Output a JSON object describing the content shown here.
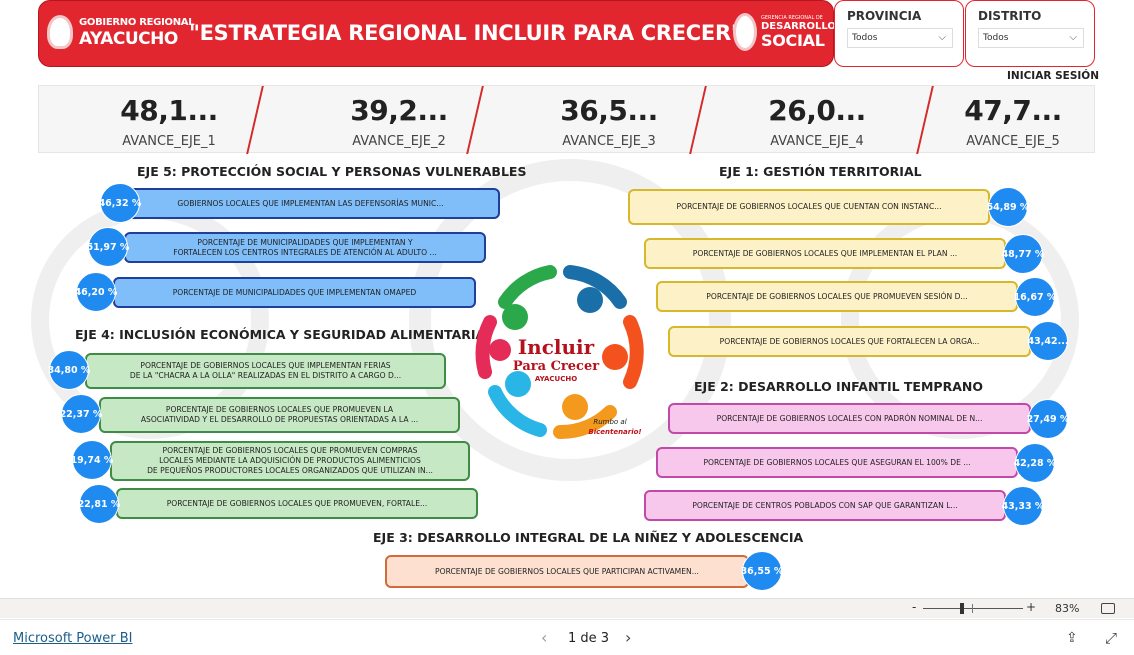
{
  "header": {
    "org_logo_line1": "GOBIERNO REGIONAL",
    "org_logo_line2": "AYACUCHO",
    "title": "\"ESTRATEGIA REGIONAL INCLUIR PARA CRECER\"",
    "dept_logo_line1": "GERENCIA REGIONAL DE",
    "dept_logo_line2": "DESARROLLO",
    "dept_logo_line3": "SOCIAL"
  },
  "filters": {
    "provincia": {
      "label": "PROVINCIA",
      "value": "Todos"
    },
    "distrito": {
      "label": "DISTRITO",
      "value": "Todos"
    }
  },
  "login_label": "INICIAR SESIÓN",
  "kpis": [
    {
      "value": "48,1...",
      "label": "AVANCE_EJE_1"
    },
    {
      "value": "39,2...",
      "label": "AVANCE_EJE_2"
    },
    {
      "value": "36,5...",
      "label": "AVANCE_EJE_3"
    },
    {
      "value": "26,0...",
      "label": "AVANCE_EJE_4"
    },
    {
      "value": "47,7...",
      "label": "AVANCE_EJE_5"
    }
  ],
  "eje5": {
    "title": "EJE 5: PROTECCIÓN SOCIAL Y PERSONAS VULNERABLES",
    "items": [
      {
        "pct": "46,32 %",
        "text": "GOBIERNOS LOCALES QUE IMPLEMENTAN LAS DEFENSORÍAS MUNIC..."
      },
      {
        "pct": "51,97 %",
        "text": "PORCENTAJE DE MUNICIPALIDADES QUE IMPLEMENTAN Y\nFORTALECEN LOS CENTROS INTEGRALES DE ATENCIÓN AL ADULTO ..."
      },
      {
        "pct": "46,20 %",
        "text": "PORCENTAJE DE MUNICIPALIDADES QUE IMPLEMENTAN OMAPED"
      }
    ]
  },
  "eje4": {
    "title": "EJE 4: INCLUSIÓN ECONÓMICA Y SEGURIDAD ALIMENTARIA",
    "items": [
      {
        "pct": "34,80 %",
        "text": "PORCENTAJE DE GOBIERNOS LOCALES QUE IMPLEMENTAN FERIAS\nDE LA \"CHACRA A LA OLLA\" REALIZADAS EN EL DISTRITO A CARGO D..."
      },
      {
        "pct": "22,37 %",
        "text": "PORCENTAJE DE GOBIERNOS LOCALES QUE PROMUEVEN LA\nASOCIATIVIDAD Y EL DESARROLLO DE PROPUESTAS ORIENTADAS A LA ..."
      },
      {
        "pct": "19,74 %",
        "text": "PORCENTAJE DE GOBIERNOS LOCALES QUE PROMUEVEN COMPRAS\nLOCALES MEDIANTE LA ADQUISICIÓN DE PRODUCTOS ALIMENTICIOS\nDE PEQUEÑOS PRODUCTORES LOCALES ORGANIZADOS QUE UTILIZAN IN..."
      },
      {
        "pct": "22,81 %",
        "text": "PORCENTAJE DE GOBIERNOS LOCALES QUE PROMUEVEN, FORTALE..."
      }
    ]
  },
  "eje1": {
    "title": "EJE 1: GESTIÓN TERRITORIAL",
    "items": [
      {
        "pct": "54,89 %",
        "text": "PORCENTAJE DE GOBIERNOS LOCALES QUE CUENTAN CON INSTANC..."
      },
      {
        "pct": "48,77 %",
        "text": "PORCENTAJE DE GOBIERNOS LOCALES QUE IMPLEMENTAN EL PLAN ..."
      },
      {
        "pct": "16,67 %",
        "text": "PORCENTAJE DE GOBIERNOS LOCALES QUE PROMUEVEN SESIÓN D..."
      },
      {
        "pct": "43,42...",
        "text": "PORCENTAJE DE GOBIERNOS LOCALES QUE FORTALECEN LA ORGA..."
      }
    ]
  },
  "eje2": {
    "title": "EJE 2: DESARROLLO INFANTIL TEMPRANO",
    "items": [
      {
        "pct": "27,49 %",
        "text": "PORCENTAJE DE GOBIERNOS LOCALES CON PADRÓN NOMINAL DE N..."
      },
      {
        "pct": "42,28 %",
        "text": "PORCENTAJE DE GOBIERNOS LOCALES QUE ASEGURAN EL 100% DE ..."
      },
      {
        "pct": "43,33 %",
        "text": "PORCENTAJE DE CENTROS POBLADOS CON SAP QUE GARANTIZAN L..."
      }
    ]
  },
  "eje3": {
    "title": "EJE 3: DESARROLLO INTEGRAL DE LA NIÑEZ Y ADOLESCENCIA",
    "items": [
      {
        "pct": "36,55 %",
        "text": "PORCENTAJE DE GOBIERNOS LOCALES QUE PARTICIPAN ACTIVAMEN..."
      }
    ]
  },
  "center_logo": {
    "line1": "Incluir",
    "line2": "Para Crecer",
    "line3": "AYACUCHO",
    "tag1": "Rumbo al",
    "tag2": "Bicentenario!"
  },
  "statusbar": {
    "zoom_minus": "-",
    "zoom_plus": "+",
    "zoom": "83%"
  },
  "footer": {
    "brand": "Microsoft Power BI",
    "prev": "‹",
    "page_indicator": "1 de 3",
    "next": "›",
    "share": "⇪",
    "expand": "⤢"
  },
  "colors": {
    "header_red": "#e1262f",
    "pct_blue": "#1f8af0",
    "eje5": "#7fbef9",
    "eje1": "#fdf1c7",
    "eje4": "#c6e8c4",
    "eje2": "#f8c8ec",
    "eje3": "#fde0d0"
  },
  "icons": [
    "chevron-down-icon",
    "fit-to-page-icon",
    "share-icon",
    "expand-icon",
    "prev-page-icon",
    "next-page-icon"
  ]
}
